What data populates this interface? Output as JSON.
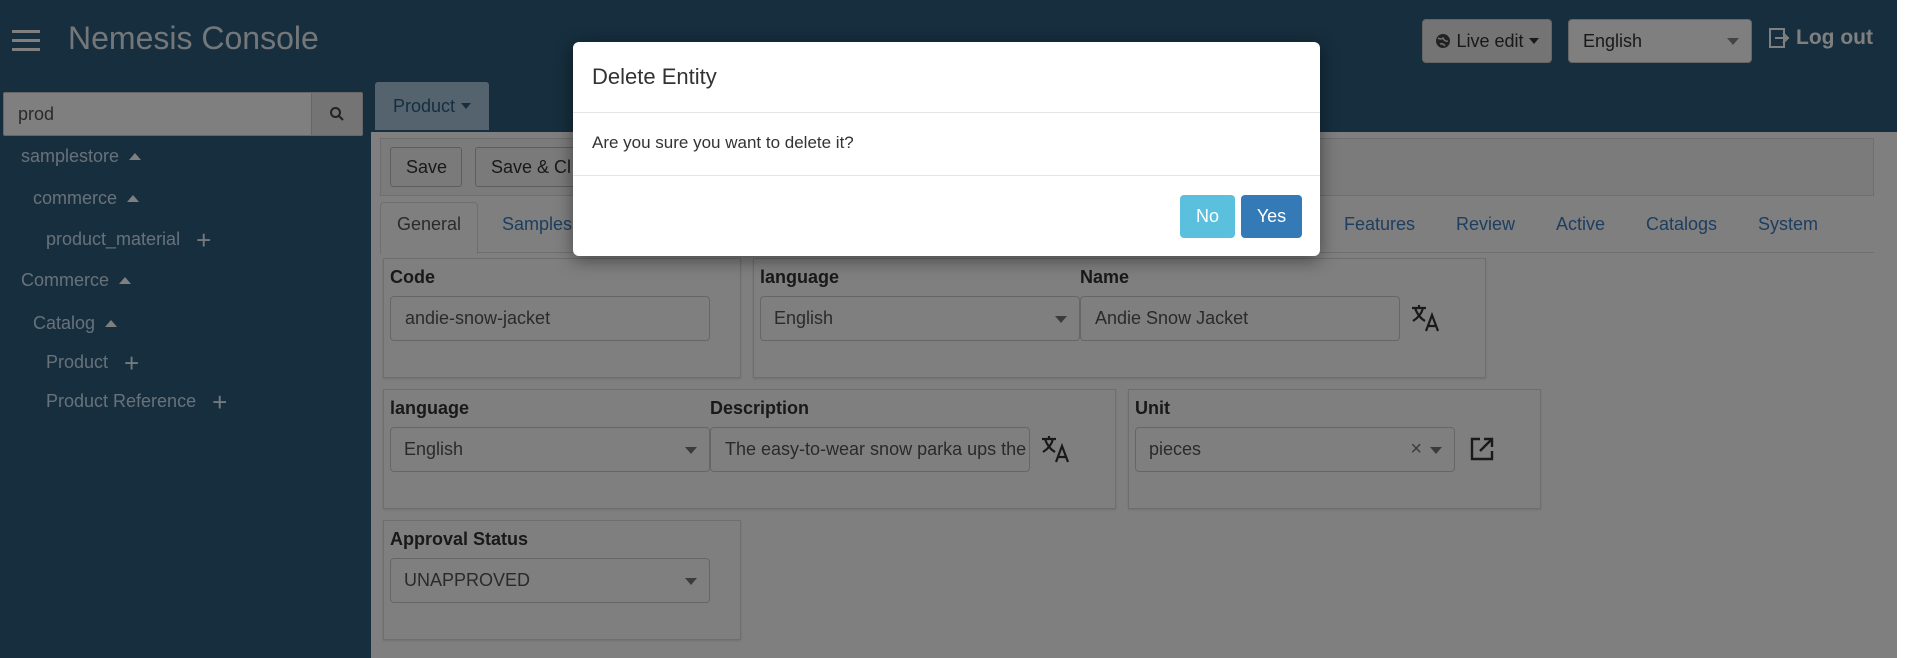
{
  "header": {
    "app_title": "Nemesis Console",
    "live_edit_label": "Live edit",
    "language_value": "English",
    "logout_label": "Log out"
  },
  "sidebar": {
    "search_value": "prod",
    "tree": {
      "samplestore": "samplestore",
      "commerce_lower": "commerce",
      "product_material": "product_material",
      "commerce": "Commerce",
      "catalog": "Catalog",
      "product": "Product",
      "product_reference": "Product Reference"
    }
  },
  "main": {
    "entity_tab": "Product",
    "toolbar": {
      "save": "Save",
      "save_close": "Save & Cl"
    },
    "tabs": {
      "general": "General",
      "samples": "Samples",
      "features": "Features",
      "review": "Review",
      "active": "Active",
      "catalogs": "Catalogs",
      "system": "System"
    },
    "form": {
      "code_label": "Code",
      "code_value": "andie-snow-jacket",
      "name_language_label": "language",
      "name_language_value": "English",
      "name_label": "Name",
      "name_value": "Andie Snow Jacket",
      "desc_language_label": "language",
      "desc_language_value": "English",
      "description_label": "Description",
      "description_value": "The easy-to-wear snow parka ups the",
      "unit_label": "Unit",
      "unit_value": "pieces",
      "unit_clear": "×",
      "approval_label": "Approval Status",
      "approval_value": "UNAPPROVED"
    }
  },
  "modal": {
    "title": "Delete Entity",
    "message": "Are you sure you want to delete it?",
    "no_label": "No",
    "yes_label": "Yes"
  }
}
